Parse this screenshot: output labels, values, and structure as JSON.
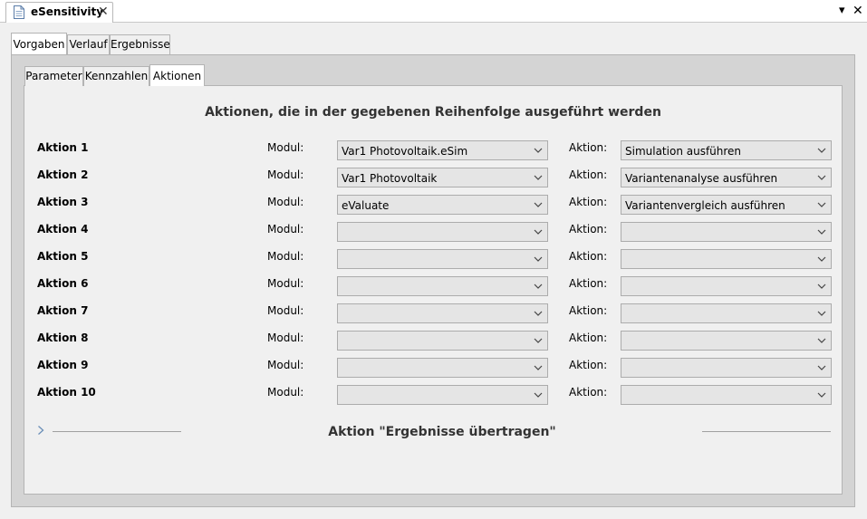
{
  "editor": {
    "tab_title": "eSensitivity",
    "close_glyph": "✕",
    "menu_glyph": "▾",
    "window_close_glyph": "✕"
  },
  "outer_tabs": [
    {
      "label": "Vorgaben",
      "active": true
    },
    {
      "label": "Verlauf",
      "active": false
    },
    {
      "label": "Ergebnisse",
      "active": false
    }
  ],
  "inner_tabs": [
    {
      "label": "Parameter",
      "active": false
    },
    {
      "label": "Kennzahlen",
      "active": false
    },
    {
      "label": "Aktionen",
      "active": true
    }
  ],
  "section": {
    "title": "Aktionen, die in der gegebenen Reihenfolge ausgeführt werden",
    "modul_label": "Modul:",
    "aktion_label": "Aktion:"
  },
  "actions": [
    {
      "label": "Aktion 1",
      "modul": "Var1 Photovoltaik.eSim",
      "aktion": "Simulation ausführen"
    },
    {
      "label": "Aktion 2",
      "modul": "Var1 Photovoltaik",
      "aktion": "Variantenanalyse ausführen"
    },
    {
      "label": "Aktion 3",
      "modul": "eValuate",
      "aktion": "Variantenvergleich ausführen"
    },
    {
      "label": "Aktion 4",
      "modul": "",
      "aktion": ""
    },
    {
      "label": "Aktion 5",
      "modul": "",
      "aktion": ""
    },
    {
      "label": "Aktion 6",
      "modul": "",
      "aktion": ""
    },
    {
      "label": "Aktion 7",
      "modul": "",
      "aktion": ""
    },
    {
      "label": "Aktion 8",
      "modul": "",
      "aktion": ""
    },
    {
      "label": "Aktion 9",
      "modul": "",
      "aktion": ""
    },
    {
      "label": "Aktion 10",
      "modul": "",
      "aktion": ""
    }
  ],
  "footer": {
    "title": "Aktion \"Ergebnisse übertragen\""
  },
  "colors": {
    "background": "#f0f0f0",
    "panel_border": "#b4b4b4",
    "select_fill": "#e5e5e5"
  }
}
